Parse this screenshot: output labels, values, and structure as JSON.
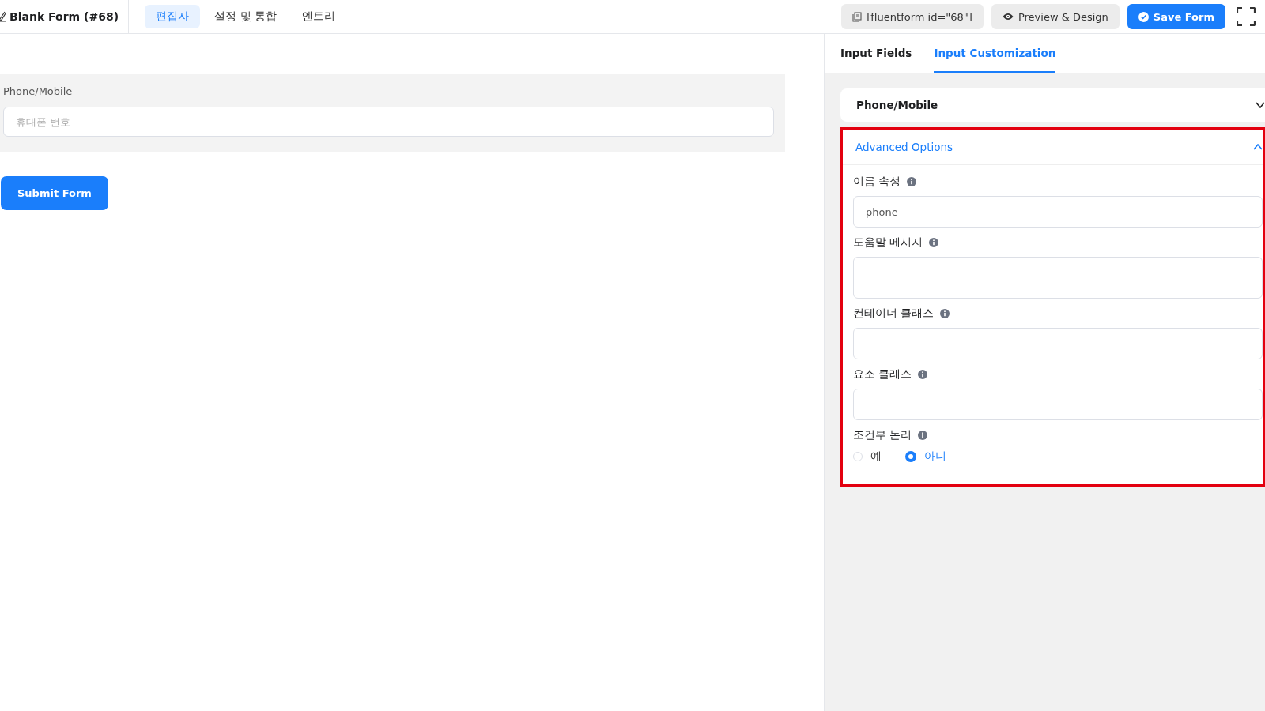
{
  "header": {
    "form_title": "Blank Form (#68)",
    "tabs": [
      {
        "label": "편집자",
        "selected": true
      },
      {
        "label": "설정 및 통합",
        "selected": false
      },
      {
        "label": "엔트리",
        "selected": false
      }
    ],
    "shortcode": "[fluentform id=\"68\"]",
    "preview_button": "Preview & Design",
    "save_button": "Save Form"
  },
  "form": {
    "field_label": "Phone/Mobile",
    "field_placeholder": "휴대폰 번호",
    "submit_button": "Submit Form"
  },
  "panel": {
    "tabs": [
      {
        "label": "Input Fields",
        "selected": false
      },
      {
        "label": "Input Customization",
        "selected": true
      }
    ],
    "field_section": {
      "title": "Phone/Mobile",
      "expanded": false
    },
    "advanced": {
      "title": "Advanced Options",
      "expanded": true,
      "highlighted": true,
      "settings": [
        {
          "kind": "text",
          "label": "이름 속성",
          "value": "phone"
        },
        {
          "kind": "textarea",
          "label": "도움말 메시지"
        },
        {
          "kind": "text",
          "label": "컨테이너 클래스"
        },
        {
          "kind": "text",
          "label": "요소 클래스"
        },
        {
          "kind": "radio",
          "label": "조건부 논리",
          "options": [
            {
              "label": "예",
              "selected": false
            },
            {
              "label": "아니",
              "selected": true
            }
          ]
        }
      ]
    }
  }
}
